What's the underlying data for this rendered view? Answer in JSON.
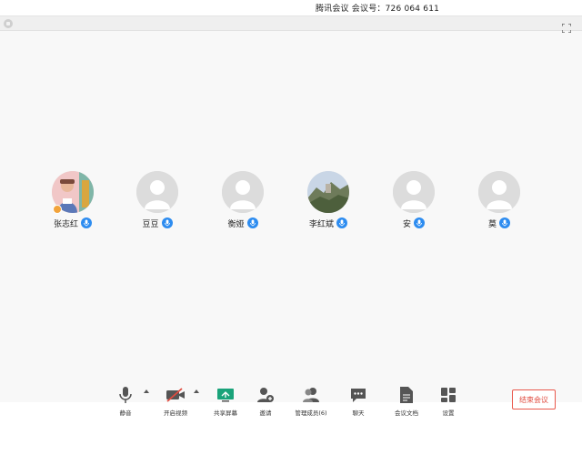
{
  "window": {
    "title": "腾讯会议 会议号：726 064 611"
  },
  "participants": [
    {
      "name": "张志红",
      "avatar": "photo-person",
      "host": true,
      "mic": "mic-on-icon"
    },
    {
      "name": "豆豆",
      "avatar": "default-avatar",
      "host": false,
      "mic": "mic-on-icon"
    },
    {
      "name": "衡娅",
      "avatar": "default-avatar",
      "host": false,
      "mic": "mic-on-icon"
    },
    {
      "name": "李红斌",
      "avatar": "photo-landscape",
      "host": false,
      "mic": "mic-on-icon"
    },
    {
      "name": "安",
      "avatar": "default-avatar",
      "host": false,
      "mic": "mic-on-icon"
    },
    {
      "name": "莫",
      "avatar": "default-avatar",
      "host": false,
      "mic": "mic-on-icon"
    }
  ],
  "toolbar": {
    "mute_label": "静音",
    "video_label": "开启视频",
    "share_label": "共享屏幕",
    "invite_label": "邀请",
    "members_label": "管理成员(6)",
    "chat_label": "聊天",
    "docs_label": "会议文档",
    "settings_label": "设置",
    "end_label": "结束会议"
  },
  "colors": {
    "accent_blue": "#2d8cf0",
    "end_red": "#e04b3f",
    "share_green": "#1aa37a",
    "video_off_red": "#e04b3f"
  }
}
